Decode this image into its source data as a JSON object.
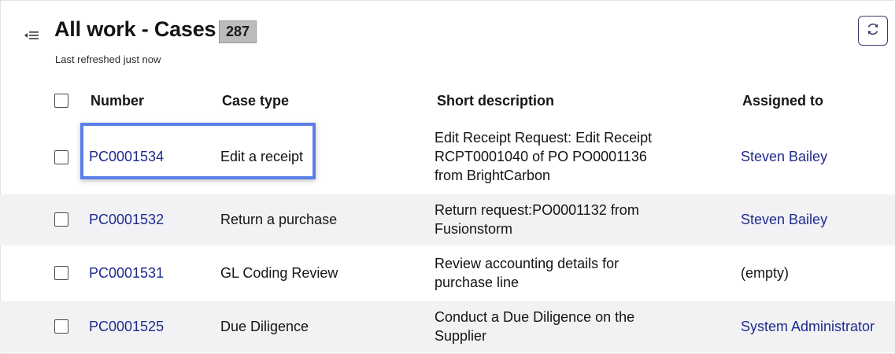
{
  "header": {
    "title": "All work - Cases",
    "count": "287",
    "refresh_note": "Last refreshed just now"
  },
  "columns": {
    "number": "Number",
    "case_type": "Case type",
    "short_description": "Short description",
    "assigned_to": "Assigned to"
  },
  "rows": [
    {
      "number": "PC0001534",
      "case_type": "Edit a receipt",
      "desc": [
        "Edit Receipt Request: Edit Receipt",
        "RCPT0001040 of PO PO0001136",
        "from BrightCarbon"
      ],
      "assigned_to": "Steven Bailey",
      "assigned_is_link": true
    },
    {
      "number": "PC0001532",
      "case_type": "Return a purchase",
      "desc": [
        "Return request:PO0001132 from",
        "Fusionstorm"
      ],
      "assigned_to": "Steven Bailey",
      "assigned_is_link": true
    },
    {
      "number": "PC0001531",
      "case_type": "GL Coding Review",
      "desc": [
        "Review accounting details for",
        "purchase line"
      ],
      "assigned_to": "(empty)",
      "assigned_is_link": false
    },
    {
      "number": "PC0001525",
      "case_type": "Due Diligence",
      "desc": [
        "Conduct a Due Diligence on the",
        "Supplier"
      ],
      "assigned_to": "System Administrator",
      "assigned_is_link": true
    }
  ],
  "colors": {
    "link": "#1e2a8c",
    "highlight": "#5b7fe8",
    "alt_row": "#f2f2f5",
    "badge_bg": "#bcbcbc"
  },
  "icons": {
    "collapse": "collapse-list-icon",
    "refresh": "refresh-icon"
  }
}
